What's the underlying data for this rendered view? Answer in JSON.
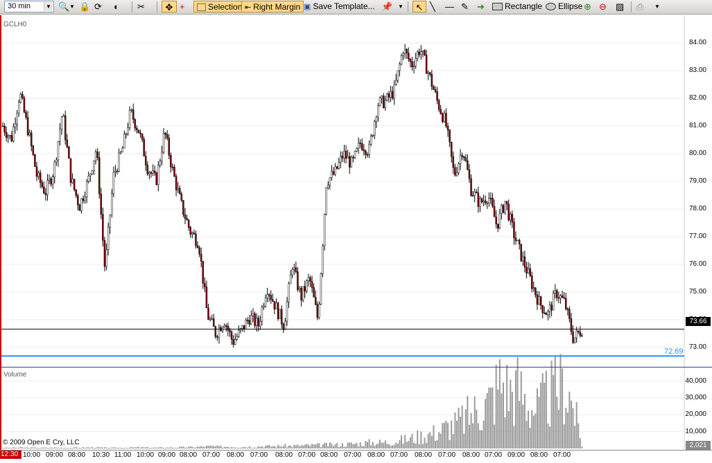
{
  "toolbar": {
    "interval": "30 min",
    "selection_label": "Selection",
    "right_margin_label": "Right Margin",
    "save_template_label": "Save Template...",
    "rectangle_label": "Rectangle",
    "ellipse_label": "Ellipse"
  },
  "chart_data": {
    "type": "candlestick",
    "symbol": "GCLH0",
    "volume_label": "Volume",
    "copyright": "© 2009 Open E Cry, LLC",
    "y_ticks": [
      "84.00",
      "83.00",
      "82.00",
      "81.00",
      "80.00",
      "79.00",
      "78.00",
      "77.00",
      "76.00",
      "75.00",
      "74.00",
      "73.00"
    ],
    "ylim": [
      72.3,
      85.0
    ],
    "current_price": "73.66",
    "horizontal_line_value": "72.69",
    "volume_ticks": [
      "40,000",
      "30,000",
      "20,000",
      "10,000"
    ],
    "volume_ylim": [
      0,
      48000
    ],
    "current_volume": "2,021",
    "x_labels": [
      "12:30",
      "10:00",
      "09:00",
      "08:00",
      "10:30",
      "11:00",
      "10:00",
      "09:00",
      "08:00",
      "07:00",
      "08:00",
      "07:00",
      "08:00",
      "07:00",
      "08:00",
      "07:00",
      "08:00",
      "07:00",
      "08:00",
      "07:00",
      "08:00",
      "07:00",
      "09:00",
      "08:00",
      "07:00"
    ],
    "price_path": [
      81.0,
      80.5,
      82.2,
      80.8,
      79.2,
      78.6,
      79.4,
      81.5,
      79.1,
      78.1,
      79.0,
      80.2,
      75.8,
      79.2,
      80.1,
      81.5,
      80.8,
      79.5,
      79.0,
      80.8,
      79.3,
      78.1,
      77.2,
      76.8,
      74.2,
      73.5,
      74.0,
      73.2,
      73.6,
      74.1,
      73.8,
      75.2,
      74.5,
      73.8,
      76.0,
      74.8,
      75.5,
      74.0,
      79.0,
      79.3,
      80.0,
      79.6,
      80.4,
      80.1,
      81.8,
      81.9,
      82.3,
      83.8,
      83.2,
      83.8,
      82.9,
      81.9,
      81.1,
      79.2,
      80.2,
      78.7,
      78.2,
      78.5,
      77.4,
      78.3,
      77.1,
      76.2,
      75.4,
      74.6,
      74.2,
      75.0,
      74.6,
      73.3,
      73.66
    ],
    "volume_path": [
      400,
      500,
      600,
      500,
      400,
      500,
      600,
      400,
      500,
      600,
      700,
      500,
      400,
      500,
      600,
      700,
      600,
      500,
      600,
      700,
      800,
      900,
      1200,
      1500,
      1100,
      1300,
      1000,
      1200,
      1400,
      1600,
      1500,
      1800,
      1700,
      1900,
      2100,
      2200,
      2500,
      2400,
      2800,
      3200,
      3600,
      4200,
      3900,
      4800,
      5500,
      6500,
      8000,
      9500,
      11000,
      14000,
      16000,
      20000,
      24000,
      28000,
      33000,
      46000,
      38000,
      41000,
      30000,
      26000,
      33000,
      38000,
      43000,
      30000,
      2021
    ]
  }
}
